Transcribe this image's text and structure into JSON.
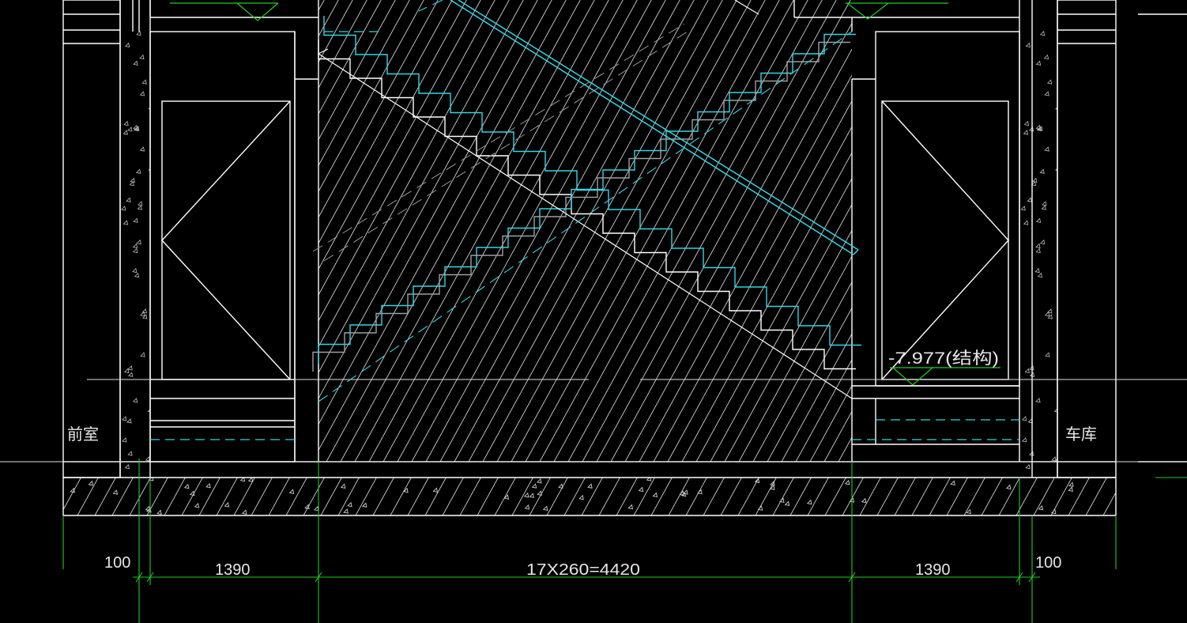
{
  "drawing": {
    "room_left": "前室",
    "room_right": "车库",
    "level_label": "-7.977(结构)",
    "dims": {
      "left_wall": "100",
      "left_landing": "1390",
      "flight": "17X260=4420",
      "right_landing": "1390",
      "right_wall": "100"
    }
  },
  "colors": {
    "background": "#000000",
    "structure": "#ffffff",
    "hatch": "#d0d0d0",
    "stair": "#33d6e6",
    "dimension": "#22cc22",
    "text": "#e6e6e6"
  }
}
